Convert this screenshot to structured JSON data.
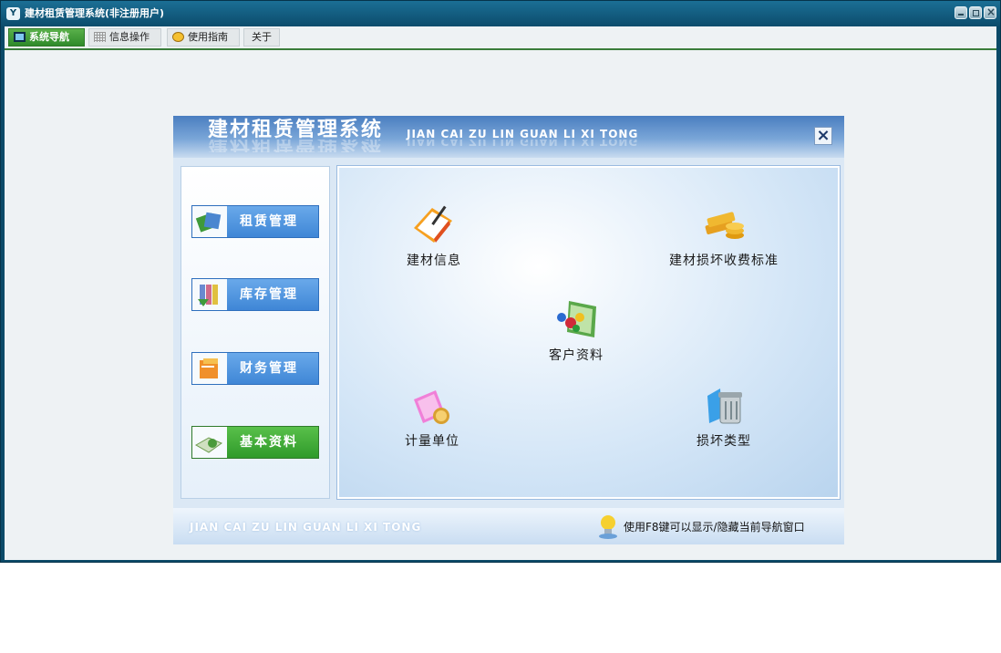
{
  "window": {
    "title": "建材租赁管理系统(非注册用户)",
    "app_icon_glyph": "Y",
    "controls": [
      "minimize",
      "restore",
      "close"
    ]
  },
  "tabs": [
    {
      "label": "系统导航",
      "icon": "monitor-icon",
      "active": true
    },
    {
      "label": "信息操作",
      "icon": "grid-icon",
      "active": false
    },
    {
      "label": "使用指南",
      "icon": "help-icon",
      "active": false
    },
    {
      "label": "关于",
      "icon": "",
      "active": false
    }
  ],
  "panel": {
    "title": "建材租赁管理系统",
    "subtitle": "JIAN CAI ZU LIN GUAN LI XI TONG",
    "close_glyph": "×",
    "menu": [
      {
        "label": "租赁管理",
        "icon": "rent-icon",
        "active": false
      },
      {
        "label": "库存管理",
        "icon": "inventory-icon",
        "active": false
      },
      {
        "label": "财务管理",
        "icon": "finance-icon",
        "active": false
      },
      {
        "label": "基本资料",
        "icon": "basic-data-icon",
        "active": true
      }
    ],
    "items": [
      {
        "label": "建材信息",
        "icon": "material-info-icon"
      },
      {
        "label": "建材损坏收费标准",
        "icon": "damage-fee-icon"
      },
      {
        "label": "客户资料",
        "icon": "customer-icon"
      },
      {
        "label": "计量单位",
        "icon": "unit-icon"
      },
      {
        "label": "损坏类型",
        "icon": "damage-type-icon"
      }
    ],
    "footer_left": "JIAN CAI ZU LIN GUAN LI XI TONG",
    "footer_hint": "使用F8键可以显示/隐藏当前导航窗口"
  },
  "colors": {
    "titlebar": "#0c4c6c",
    "active_tab": "#2f8a2a",
    "menu_button": "#3f86d6",
    "menu_button_active": "#2f9a2a"
  }
}
